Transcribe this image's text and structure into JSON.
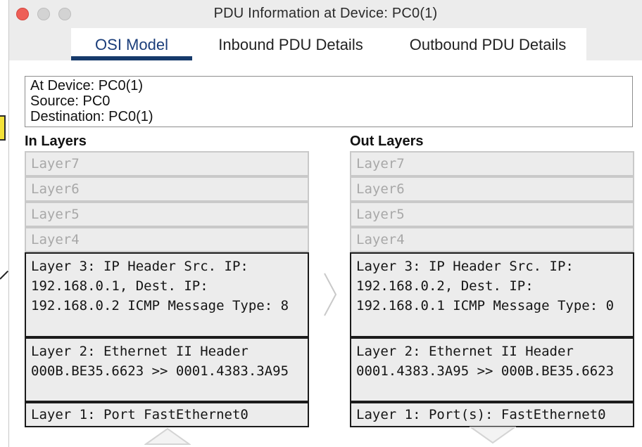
{
  "window": {
    "title": "PDU Information at Device: PC0(1)"
  },
  "tabs": [
    {
      "label": "OSI Model"
    },
    {
      "label": "Inbound PDU Details"
    },
    {
      "label": "Outbound PDU Details"
    }
  ],
  "info": {
    "device": "At Device: PC0(1)",
    "source": "Source: PC0",
    "destination": "Destination: PC0(1)"
  },
  "in_layers": {
    "title": "In Layers",
    "layer7": "Layer7",
    "layer6": "Layer6",
    "layer5": "Layer5",
    "layer4": "Layer4",
    "layer3": "Layer 3: IP Header Src. IP: 192.168.0.1, Dest. IP: 192.168.0.2 ICMP Message Type: 8",
    "layer2": "Layer 2: Ethernet II Header 000B.BE35.6623 >> 0001.4383.3A95",
    "layer1": "Layer 1: Port FastEthernet0"
  },
  "out_layers": {
    "title": "Out Layers",
    "layer7": "Layer7",
    "layer6": "Layer6",
    "layer5": "Layer5",
    "layer4": "Layer4",
    "layer3": "Layer 3: IP Header Src. IP: 192.168.0.2, Dest. IP: 192.168.0.1 ICMP Message Type: 0",
    "layer2": "Layer 2: Ethernet II Header 0001.4383.3A95 >> 000B.BE35.6623",
    "layer1": "Layer 1: Port(s): FastEthernet0"
  },
  "colors": {
    "close_button": "#ee5f57",
    "tab_underline": "#163a6b",
    "background_marker": "#f4e23a"
  },
  "icons": {
    "close": "close-icon",
    "minimize": "minimize-icon",
    "maximize": "maximize-icon",
    "next_arrow": "chevron-right-icon",
    "scroll_up": "chevron-up-icon",
    "scroll_down": "chevron-down-icon"
  }
}
